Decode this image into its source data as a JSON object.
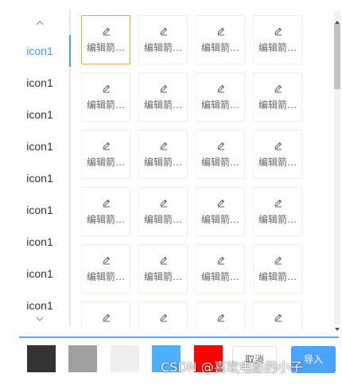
{
  "tabs": {
    "items": [
      {
        "label": "icon1",
        "active": true
      },
      {
        "label": "icon1",
        "active": false
      },
      {
        "label": "icon1",
        "active": false
      },
      {
        "label": "icon1",
        "active": false
      },
      {
        "label": "icon1",
        "active": false
      },
      {
        "label": "icon1",
        "active": false
      },
      {
        "label": "icon1",
        "active": false
      },
      {
        "label": "icon1",
        "active": false
      },
      {
        "label": "icon1",
        "active": false
      }
    ],
    "scroll_up_icon": "chevron-up-icon",
    "scroll_down_icon": "chevron-down-icon"
  },
  "grid": {
    "cell_icon": "edit-pencil-icon",
    "cells": [
      {
        "label": "编辑箭…",
        "selected": true
      },
      {
        "label": "编辑箭…",
        "selected": false
      },
      {
        "label": "编辑箭…",
        "selected": false
      },
      {
        "label": "编辑箭…",
        "selected": false
      },
      {
        "label": "编辑箭…",
        "selected": false
      },
      {
        "label": "编辑箭…",
        "selected": false
      },
      {
        "label": "编辑箭…",
        "selected": false
      },
      {
        "label": "编辑箭…",
        "selected": false
      },
      {
        "label": "编辑箭…",
        "selected": false
      },
      {
        "label": "编辑箭…",
        "selected": false
      },
      {
        "label": "编辑箭…",
        "selected": false
      },
      {
        "label": "编辑箭…",
        "selected": false
      },
      {
        "label": "编辑箭…",
        "selected": false
      },
      {
        "label": "编辑箭…",
        "selected": false
      },
      {
        "label": "编辑箭…",
        "selected": false
      },
      {
        "label": "编辑箭…",
        "selected": false
      },
      {
        "label": "编辑箭…",
        "selected": false
      },
      {
        "label": "编辑箭…",
        "selected": false
      },
      {
        "label": "编辑箭…",
        "selected": false
      },
      {
        "label": "编辑箭…",
        "selected": false
      },
      {
        "label": "编辑箭…",
        "selected": false
      },
      {
        "label": "编辑箭…",
        "selected": false
      },
      {
        "label": "编辑箭…",
        "selected": false
      },
      {
        "label": "编辑箭…",
        "selected": false
      }
    ]
  },
  "footer": {
    "swatches": [
      {
        "name": "dark-gray",
        "color": "#333333"
      },
      {
        "name": "gray",
        "color": "#a0a0a0"
      },
      {
        "name": "light-gray",
        "color": "#eeeeee"
      },
      {
        "name": "blue",
        "color": "#4db0ff"
      },
      {
        "name": "red",
        "color": "#ff0000"
      }
    ],
    "cancel_label": "取消",
    "import_label": "导入"
  },
  "watermark": "CSDN @喜欢电影的小子",
  "colors": {
    "accent": "#409eff",
    "selected_border": "#e6a23c"
  }
}
